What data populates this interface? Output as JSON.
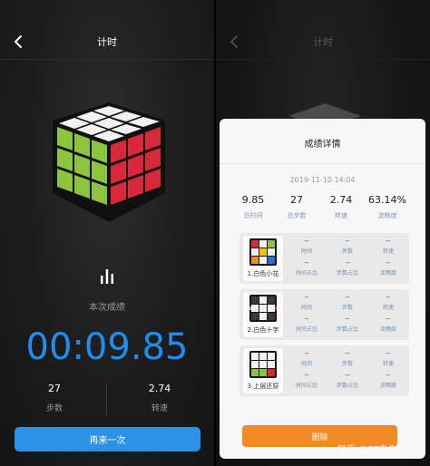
{
  "left": {
    "header": {
      "title": "计时"
    },
    "result_label": "本次成绩",
    "time": "00:09.85",
    "stats": [
      {
        "value": "27",
        "label": "步数"
      },
      {
        "value": "2.74",
        "label": "转速"
      }
    ],
    "button": "再来一次"
  },
  "right": {
    "header": {
      "title": "计时"
    },
    "modal": {
      "title": "成绩详情",
      "date": "2019-11-10 14:04",
      "summary": [
        {
          "value": "9.85",
          "label": "总时间"
        },
        {
          "value": "27",
          "label": "总步数"
        },
        {
          "value": "2.74",
          "label": "转速"
        },
        {
          "value": "63.14%",
          "label": "流畅度"
        }
      ],
      "stages": [
        {
          "name": "1.白色小花",
          "cells": [
            {
              "value": "--",
              "label": "时间"
            },
            {
              "value": "--",
              "label": "步数"
            },
            {
              "value": "--",
              "label": "转速"
            },
            {
              "value": "--",
              "label": "时间占比"
            },
            {
              "value": "--",
              "label": "步数占比"
            },
            {
              "value": "--",
              "label": "流畅度"
            }
          ]
        },
        {
          "name": "2.白色十字",
          "cells": [
            {
              "value": "--",
              "label": "时间"
            },
            {
              "value": "--",
              "label": "步数"
            },
            {
              "value": "--",
              "label": "转速"
            },
            {
              "value": "--",
              "label": "时间占比"
            },
            {
              "value": "--",
              "label": "步数占比"
            },
            {
              "value": "--",
              "label": "流畅度"
            }
          ]
        },
        {
          "name": "3.上层还原",
          "cells": [
            {
              "value": "--",
              "label": "时间"
            },
            {
              "value": "--",
              "label": "步数"
            },
            {
              "value": "--",
              "label": "转速"
            },
            {
              "value": "--",
              "label": "时间占比"
            },
            {
              "value": "--",
              "label": "步数占比"
            },
            {
              "value": "--",
              "label": "流畅度"
            }
          ]
        }
      ],
      "delete_button": "删除"
    }
  },
  "watermark": "知乎 @3T先生",
  "colors": {
    "accent_blue": "#1f8fef",
    "button_blue": "#2b92e8",
    "delete_orange": "#f28a25"
  }
}
